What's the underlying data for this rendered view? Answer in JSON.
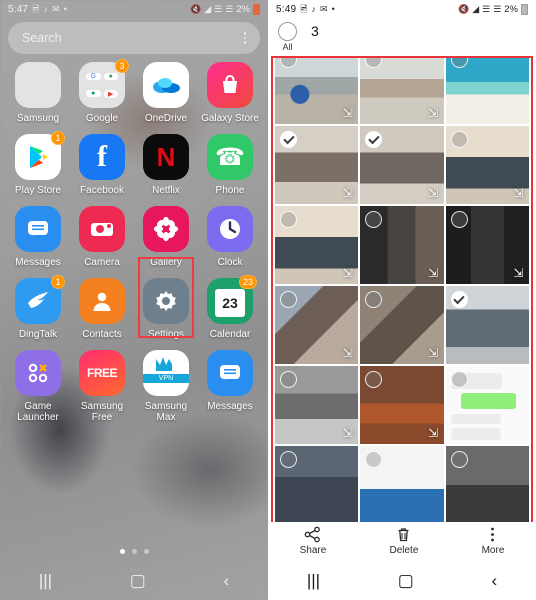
{
  "left": {
    "status": {
      "time": "5:47",
      "icons": [
        "image-icon",
        "tiktok-icon",
        "mail-icon",
        "dot-icon"
      ],
      "mute": "mute-icon",
      "wifi": "wifi-icon",
      "battery": "2%"
    },
    "search": {
      "placeholder": "Search",
      "menu": "more-options-icon"
    },
    "apps": [
      {
        "label": "Samsung",
        "icon": "samsung-folder",
        "badge": ""
      },
      {
        "label": "Google",
        "icon": "google-folder",
        "badge": "3"
      },
      {
        "label": "OneDrive",
        "icon": "onedrive-icon",
        "badge": ""
      },
      {
        "label": "Galaxy Store",
        "icon": "galaxy-store-icon",
        "badge": ""
      },
      {
        "label": "Play Store",
        "icon": "play-store-icon",
        "badge": "1"
      },
      {
        "label": "Facebook",
        "icon": "facebook-icon",
        "badge": ""
      },
      {
        "label": "Netflix",
        "icon": "netflix-icon",
        "badge": ""
      },
      {
        "label": "Phone",
        "icon": "phone-icon",
        "badge": ""
      },
      {
        "label": "Messages",
        "icon": "messages-icon",
        "badge": ""
      },
      {
        "label": "Camera",
        "icon": "camera-icon",
        "badge": ""
      },
      {
        "label": "Gallery",
        "icon": "gallery-icon",
        "badge": ""
      },
      {
        "label": "Clock",
        "icon": "clock-icon",
        "badge": ""
      },
      {
        "label": "DingTalk",
        "icon": "dingtalk-icon",
        "badge": "1"
      },
      {
        "label": "Contacts",
        "icon": "contacts-icon",
        "badge": ""
      },
      {
        "label": "Settings",
        "icon": "settings-icon",
        "badge": ""
      },
      {
        "label": "Calendar",
        "icon": "calendar-icon",
        "badge": "23"
      },
      {
        "label": "Game Launcher",
        "icon": "game-launcher-icon",
        "badge": ""
      },
      {
        "label": "Samsung Free",
        "icon": "samsung-free-icon",
        "badge": ""
      },
      {
        "label": "Samsung Max",
        "icon": "samsung-max-icon",
        "badge": ""
      },
      {
        "label": "Messages",
        "icon": "messages-icon",
        "badge": ""
      }
    ],
    "highlight": {
      "target": "Gallery",
      "color": "#ef3b42"
    },
    "pages": {
      "count": 3,
      "active": 1
    },
    "nav": {
      "recents": "|||",
      "home": "▢",
      "back": "‹"
    }
  },
  "right": {
    "status": {
      "time": "5:49",
      "battery": "2%"
    },
    "header": {
      "select_all_label": "All",
      "selected_count": "3"
    },
    "annotation_color": "#e8333a",
    "thumbnails": [
      {
        "name": "billiard-room-photo",
        "scene": "s-room1",
        "checked": false,
        "burst": true
      },
      {
        "name": "cafe-interior-photo",
        "scene": "s-room2",
        "checked": false,
        "burst": true
      },
      {
        "name": "resort-promo-image",
        "scene": "s-ad",
        "checked": false,
        "burst": false
      },
      {
        "name": "group-certificate-photo-1",
        "scene": "s-grp1",
        "checked": true,
        "burst": true
      },
      {
        "name": "group-certificate-photo-2",
        "scene": "s-grp2",
        "checked": true,
        "burst": true
      },
      {
        "name": "acethinker-banner-photo",
        "scene": "s-ace",
        "checked": false,
        "burst": true
      },
      {
        "name": "acethinker-award-photo",
        "scene": "s-ace",
        "checked": false,
        "burst": true
      },
      {
        "name": "video-call-screenshot-1",
        "scene": "s-call1",
        "checked": false,
        "burst": true
      },
      {
        "name": "video-call-screenshot-2",
        "scene": "s-call2",
        "checked": false,
        "burst": true
      },
      {
        "name": "laptop-collage-photo",
        "scene": "s-coll",
        "checked": false,
        "burst": true
      },
      {
        "name": "workshop-collage-photo",
        "scene": "s-coll2",
        "checked": false,
        "burst": true
      },
      {
        "name": "crowd-group-photo",
        "scene": "s-crowd",
        "checked": true,
        "burst": false
      },
      {
        "name": "kitchen-child-photo",
        "scene": "s-kitch",
        "checked": false,
        "burst": true
      },
      {
        "name": "party-room-photo",
        "scene": "s-room3",
        "checked": false,
        "burst": true
      },
      {
        "name": "chat-screenshot",
        "scene": "s-chat",
        "checked": false,
        "burst": false
      },
      {
        "name": "night-event-photo",
        "scene": "s-part",
        "checked": false,
        "burst": false
      },
      {
        "name": "giwa-banner-photo",
        "scene": "s-gmr",
        "checked": false,
        "burst": false
      },
      {
        "name": "dark-scene-photo",
        "scene": "s-dark",
        "checked": false,
        "burst": false
      }
    ],
    "toolbar": [
      {
        "label": "Share",
        "icon": "share-icon"
      },
      {
        "label": "Delete",
        "icon": "trash-icon"
      },
      {
        "label": "More",
        "icon": "more-vertical-icon"
      }
    ],
    "nav": {
      "recents": "|||",
      "home": "▢",
      "back": "‹"
    }
  }
}
